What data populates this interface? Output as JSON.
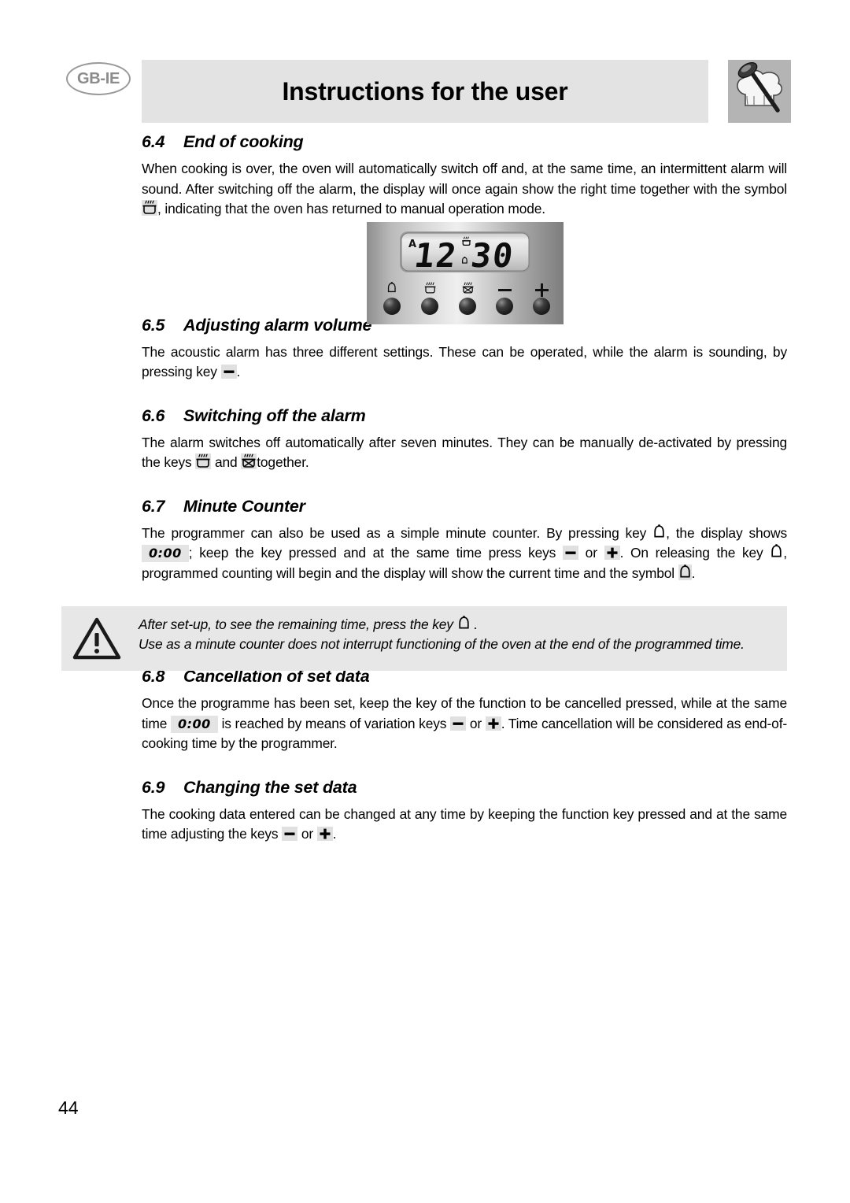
{
  "header": {
    "locale_badge": "GB-IE",
    "title": "Instructions for the user",
    "chef_icon": "chef-hat-spoon-icon"
  },
  "page_number": "44",
  "sections": [
    {
      "number": "6.4",
      "title": "End of cooking",
      "paragraph_1": "When cooking is over, the oven will automatically switch off and, at the same time, an intermittent alarm will sound. After switching off the alarm, the display will once again show the right time together with the symbol",
      "paragraph_2": ", indicating that the oven has returned to manual operation mode."
    },
    {
      "number": "6.5",
      "title": "Adjusting alarm volume",
      "paragraph_1": "The acoustic alarm has three different settings. These can be operated, while the alarm is sounding, by pressing key",
      "paragraph_2": "."
    },
    {
      "number": "6.6",
      "title": "Switching off the alarm",
      "paragraph_1": "The alarm switches off automatically after seven minutes. They can be manually de-activated by pressing the keys",
      "paragraph_2": "and",
      "paragraph_3": "together."
    },
    {
      "number": "6.7",
      "title": "Minute Counter",
      "paragraph_1": "The programmer can also be used as a simple minute counter. By pressing key",
      "paragraph_2": ", the display shows",
      "lcd_value": "0:00",
      "paragraph_3": "; keep the key pressed and at the same time press keys",
      "paragraph_4": "or",
      "paragraph_5": ". On releasing the key",
      "paragraph_6": ", programmed counting will begin and the display will show the current time and the symbol",
      "paragraph_7": "."
    },
    {
      "number": "6.8",
      "title": "Cancellation of set data",
      "paragraph_1": "Once the programme has been set, keep the key of the function to be cancelled pressed, while at the same time",
      "lcd_value": "0:00",
      "paragraph_2": "is reached by means of variation keys",
      "paragraph_3": "or",
      "paragraph_4": ". Time cancellation will be considered as end-of-cooking time by the programmer."
    },
    {
      "number": "6.9",
      "title": "Changing the set data",
      "paragraph_1": "The cooking data entered can be changed at any time by keeping the function key pressed and at the same time adjusting the keys",
      "paragraph_2": "or",
      "paragraph_3": "."
    }
  ],
  "note_box": {
    "icon": "warning-triangle-icon",
    "line_1_before": "After set-up, to see the remaining time, press the key",
    "line_1_after": ".",
    "line_2": "Use as a minute counter does not interrupt functioning of the oven at the end of the programmed time."
  },
  "oven_panel": {
    "display_value": "12.30",
    "display_hours": "12",
    "display_minutes": "30",
    "auto_indicator": "A",
    "lcd_cooking_symbol": "cooking-heat-icon",
    "lcd_bell_symbol": "bell-icon",
    "buttons": [
      {
        "name": "bell-key",
        "symbol": "bell-icon"
      },
      {
        "name": "cooking-time-key",
        "symbol": "cooking-heat-icon"
      },
      {
        "name": "end-of-cooking-key",
        "symbol": "end-of-cooking-icon"
      },
      {
        "name": "minus-key",
        "symbol": "minus-icon"
      },
      {
        "name": "plus-key",
        "symbol": "plus-icon"
      }
    ]
  },
  "colors": {
    "header_bar_bg": "#e3e3e3",
    "chef_box_bg": "#b4b4b4",
    "note_bg": "#e7e7e7",
    "key_chip_bg": "#e0e0e0",
    "badge_stroke": "#9a9a9a",
    "badge_text": "#8c8c8c"
  }
}
